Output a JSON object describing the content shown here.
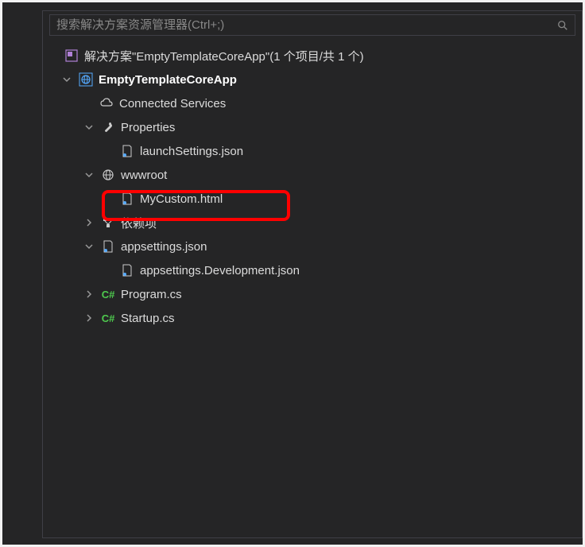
{
  "search": {
    "placeholder": "搜索解决方案资源管理器(Ctrl+;)"
  },
  "solution": {
    "label": "解决方案\"EmptyTemplateCoreApp\"(1 个项目/共 1 个)"
  },
  "project": {
    "label": "EmptyTemplateCoreApp"
  },
  "nodes": {
    "connectedServices": "Connected Services",
    "properties": "Properties",
    "launchSettings": "launchSettings.json",
    "wwwroot": "wwwroot",
    "myCustom": "MyCustom.html",
    "dependencies": "依赖项",
    "appsettings": "appsettings.json",
    "appsettingsDev": "appsettings.Development.json",
    "program": "Program.cs",
    "startup": "Startup.cs"
  },
  "colors": {
    "csharp": "#4ec94e",
    "accent": "#55aaff"
  }
}
